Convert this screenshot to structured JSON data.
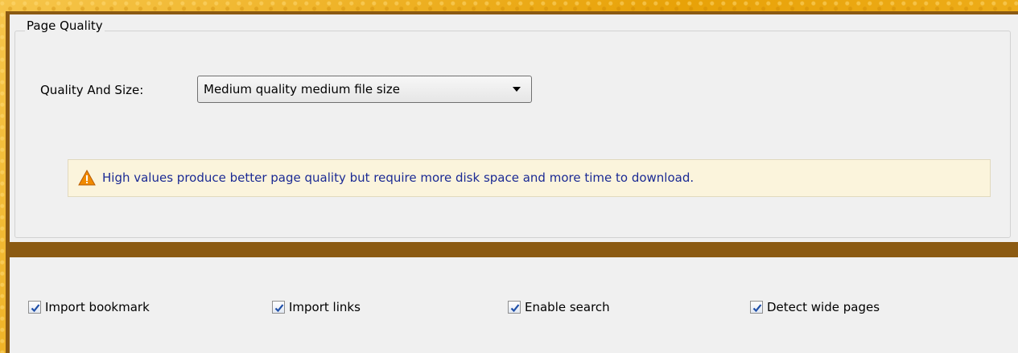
{
  "page_quality": {
    "group_title": "Page Quality",
    "quality_label": "Quality And Size:",
    "quality_value": "Medium quality medium file size",
    "notice_text": "High values produce better page quality but require more disk space and more time to download."
  },
  "options": [
    {
      "label": "Import bookmark",
      "checked": true
    },
    {
      "label": "Import links",
      "checked": true
    },
    {
      "label": "Enable search",
      "checked": true
    },
    {
      "label": "Detect wide pages",
      "checked": true
    }
  ],
  "colors": {
    "notice_text": "#1b2a94",
    "notice_bg": "#fbf4dc",
    "frame": "#8b5a12",
    "checkmark": "#1f4fa8",
    "warning_icon": "#f08a00"
  },
  "icons": {
    "warning": "warning-triangle-icon",
    "dropdown": "chevron-down-icon",
    "check": "checkmark-icon"
  }
}
